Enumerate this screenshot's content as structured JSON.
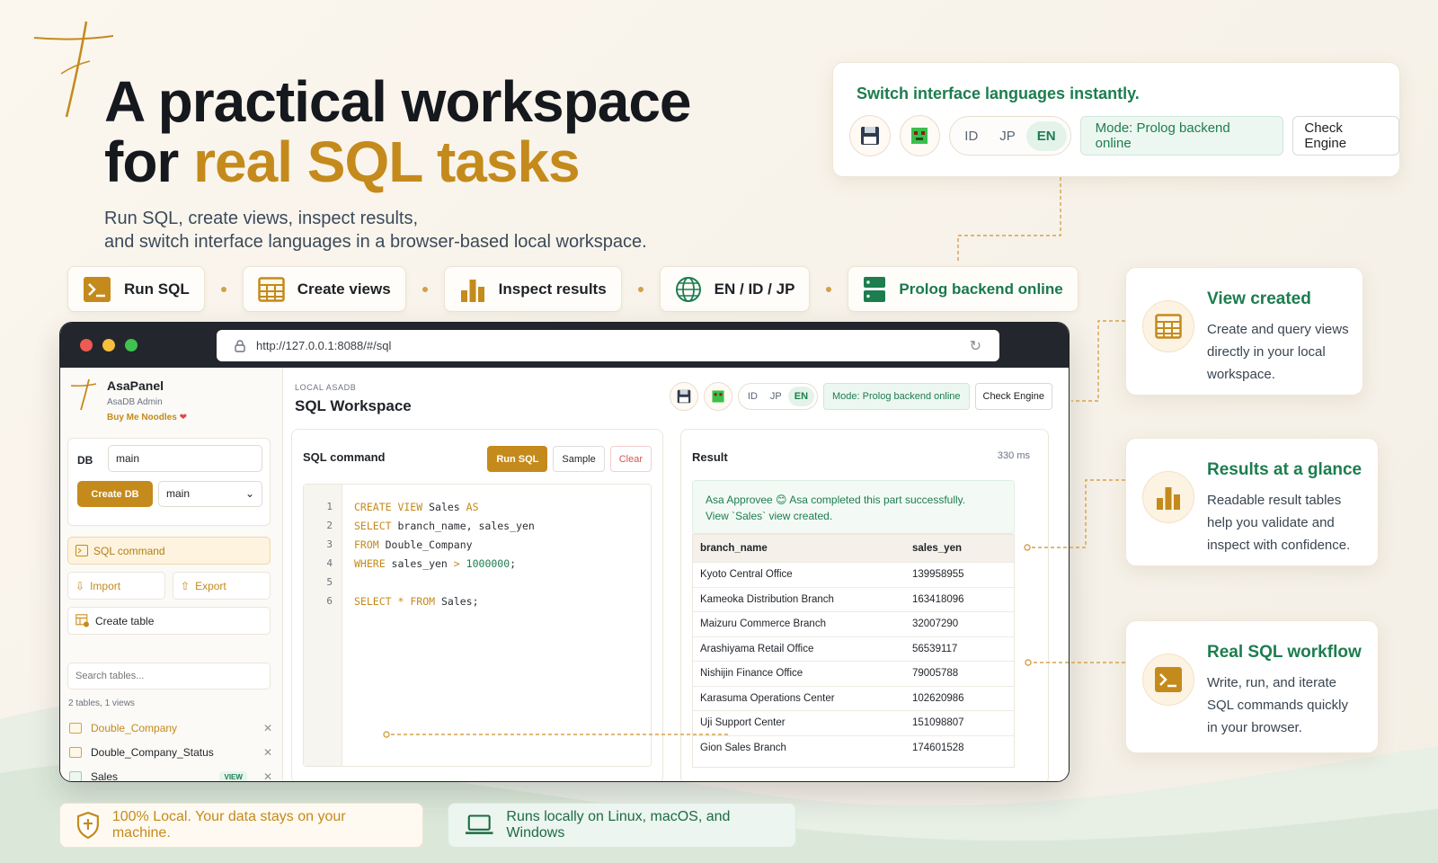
{
  "hero": {
    "title_line1": "A practical  workspace",
    "title_line2_prefix": "for ",
    "title_line2_accent": "real SQL tasks",
    "subtitle_line1": "Run SQL, create views, inspect results,",
    "subtitle_line2": "and switch interface languages in a browser-based local workspace."
  },
  "features": [
    {
      "label": "Run SQL",
      "icon": "terminal-icon"
    },
    {
      "label": "Create views",
      "icon": "table-icon"
    },
    {
      "label": "Inspect results",
      "icon": "bar-chart-icon"
    },
    {
      "label": "EN / ID / JP",
      "icon": "globe-icon"
    },
    {
      "label": "Prolog backend online",
      "icon": "server-icon"
    }
  ],
  "lang_card": {
    "title": "Switch interface languages instantly.",
    "langs": [
      "ID",
      "JP",
      "EN"
    ],
    "active_lang": "EN",
    "mode": "Mode: Prolog backend online",
    "check_engine": "Check Engine"
  },
  "browser": {
    "url": "http://127.0.0.1:8088/#/sql"
  },
  "sidebar": {
    "app_name": "AsaPanel",
    "app_sub": "AsaDB Admin",
    "support": "Buy Me Noodles",
    "db_label": "DB",
    "db_input": "main",
    "create_db": "Create DB",
    "db_select": "main",
    "nav_sql": "SQL command",
    "nav_import": "Import",
    "nav_export": "Export",
    "nav_create_table": "Create table",
    "search_placeholder": "Search tables...",
    "counts": "2 tables, 1 views",
    "tables": [
      {
        "name": "Double_Company",
        "view": false,
        "highlight": true
      },
      {
        "name": "Double_Company_Status",
        "view": false,
        "highlight": false
      },
      {
        "name": "Sales",
        "view": true,
        "highlight": false
      }
    ],
    "view_tag": "VIEW"
  },
  "main": {
    "crumb": "LOCAL ASADB",
    "title": "SQL Workspace",
    "langs": [
      "ID",
      "JP",
      "EN"
    ],
    "mode": "Mode: Prolog backend online",
    "check_engine": "Check Engine",
    "sql_title": "SQL command",
    "run": "Run SQL",
    "sample": "Sample",
    "clear": "Clear",
    "result_title": "Result",
    "timing": "330 ms",
    "success_line1": "Asa Approvee 😊 Asa completed this part successfully.",
    "success_line2": "View `Sales` view created."
  },
  "code_lines": [
    "1",
    "2",
    "3",
    "4",
    "5",
    "6"
  ],
  "result_table": {
    "columns": [
      "branch_name",
      "sales_yen"
    ],
    "rows": [
      [
        "Kyoto Central Office",
        "139958955"
      ],
      [
        "Kameoka Distribution Branch",
        "163418096"
      ],
      [
        "Maizuru Commerce Branch",
        "32007290"
      ],
      [
        "Arashiyama Retail Office",
        "56539117"
      ],
      [
        "Nishijin Finance Office",
        "79005788"
      ],
      [
        "Karasuma Operations Center",
        "102620986"
      ],
      [
        "Uji Support Center",
        "151098807"
      ],
      [
        "Gion Sales Branch",
        "174601528"
      ]
    ]
  },
  "cards": [
    {
      "title": "View created",
      "desc_line1": "Create and query views",
      "desc_line2": "directly in your local",
      "desc_line3": "workspace."
    },
    {
      "title": "Results at a glance",
      "desc_line1": "Readable result tables",
      "desc_line2": "help you validate and",
      "desc_line3": "inspect with confidence."
    },
    {
      "title": "Real SQL workflow",
      "desc_line1": "Write, run, and iterate",
      "desc_line2": "SQL commands quickly",
      "desc_line3": "in your browser."
    }
  ],
  "bottom": {
    "local": "100% Local. Your data stays on your machine.",
    "platforms": "Runs locally on Linux, macOS, and Windows"
  },
  "colors": {
    "accent": "#c48a1c",
    "green": "#1d7d4f",
    "window_dark": "#23272d"
  }
}
